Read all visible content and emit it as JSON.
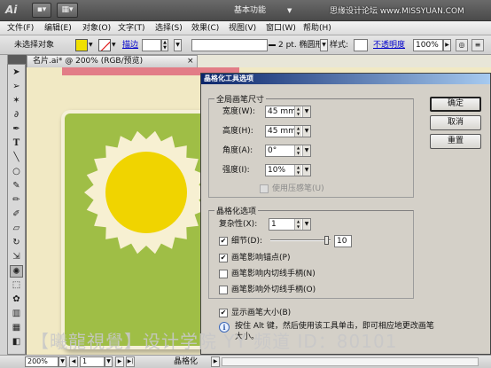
{
  "app": {
    "logo": "Ai"
  },
  "titlebar": {
    "workspace_label": "基本功能",
    "watermark": "思缘设计论坛 www.MISSYUAN.COM"
  },
  "menu": [
    "文件(F)",
    "编辑(E)",
    "对象(O)",
    "文字(T)",
    "选择(S)",
    "效果(C)",
    "视图(V)",
    "窗口(W)",
    "帮助(H)"
  ],
  "control_bar": {
    "selection_label": "未选择对象",
    "stroke_label": "描边",
    "brush_label": "2 pt. 椭圆形",
    "style_label": "样式:",
    "opacity_label": "不透明度",
    "opacity_value": "100",
    "opacity_unit": "%",
    "fill_color": "#f0e000"
  },
  "document": {
    "tab_title": "名片.ai* @ 200% (RGB/预览)",
    "close_glyph": "×"
  },
  "artwork": {
    "strip_color": "#e27d87",
    "tile_color": "#9fbe46",
    "sun_color": "#f0d400",
    "sun_halo_color": "#f7f0d2"
  },
  "dialog": {
    "title": "晶格化工具选项",
    "global": {
      "legend": "全局画笔尺寸",
      "width_label": "宽度(W):",
      "width_value": "45 mm",
      "height_label": "高度(H):",
      "height_value": "45 mm",
      "angle_label": "角度(A):",
      "angle_value": "0°",
      "intensity_label": "强度(I):",
      "intensity_value": "10%",
      "pressure_label": "使用压感笔(U)"
    },
    "options": {
      "legend": "晶格化选项",
      "complexity_label": "复杂性(X):",
      "complexity_value": "1",
      "detail_label": "细节(D):",
      "detail_value": "10",
      "detail_level": 0.95,
      "brush_anchor_label": "画笔影响锚点(P)",
      "brush_in_tangent_label": "画笔影响内切线手柄(N)",
      "brush_out_tangent_label": "画笔影响外切线手柄(O)"
    },
    "show_brush_size_label": "显示画笔大小(B)",
    "tip": "按住 Alt 键，然后使用该工具单击，即可相应地更改画笔大小。",
    "buttons": {
      "ok": "确定",
      "cancel": "取消",
      "reset": "重置"
    },
    "checks": {
      "detail": true,
      "brush_anchor": true,
      "brush_in_tangent": false,
      "brush_out_tangent": false,
      "show_brush_size": true,
      "pressure": false
    }
  },
  "status_bar": {
    "zoom": "200%",
    "page": "1",
    "tool": "晶格化"
  },
  "watermark_bottom": "【曦龍視覺】设计学院 YY 频道 ID：80101"
}
